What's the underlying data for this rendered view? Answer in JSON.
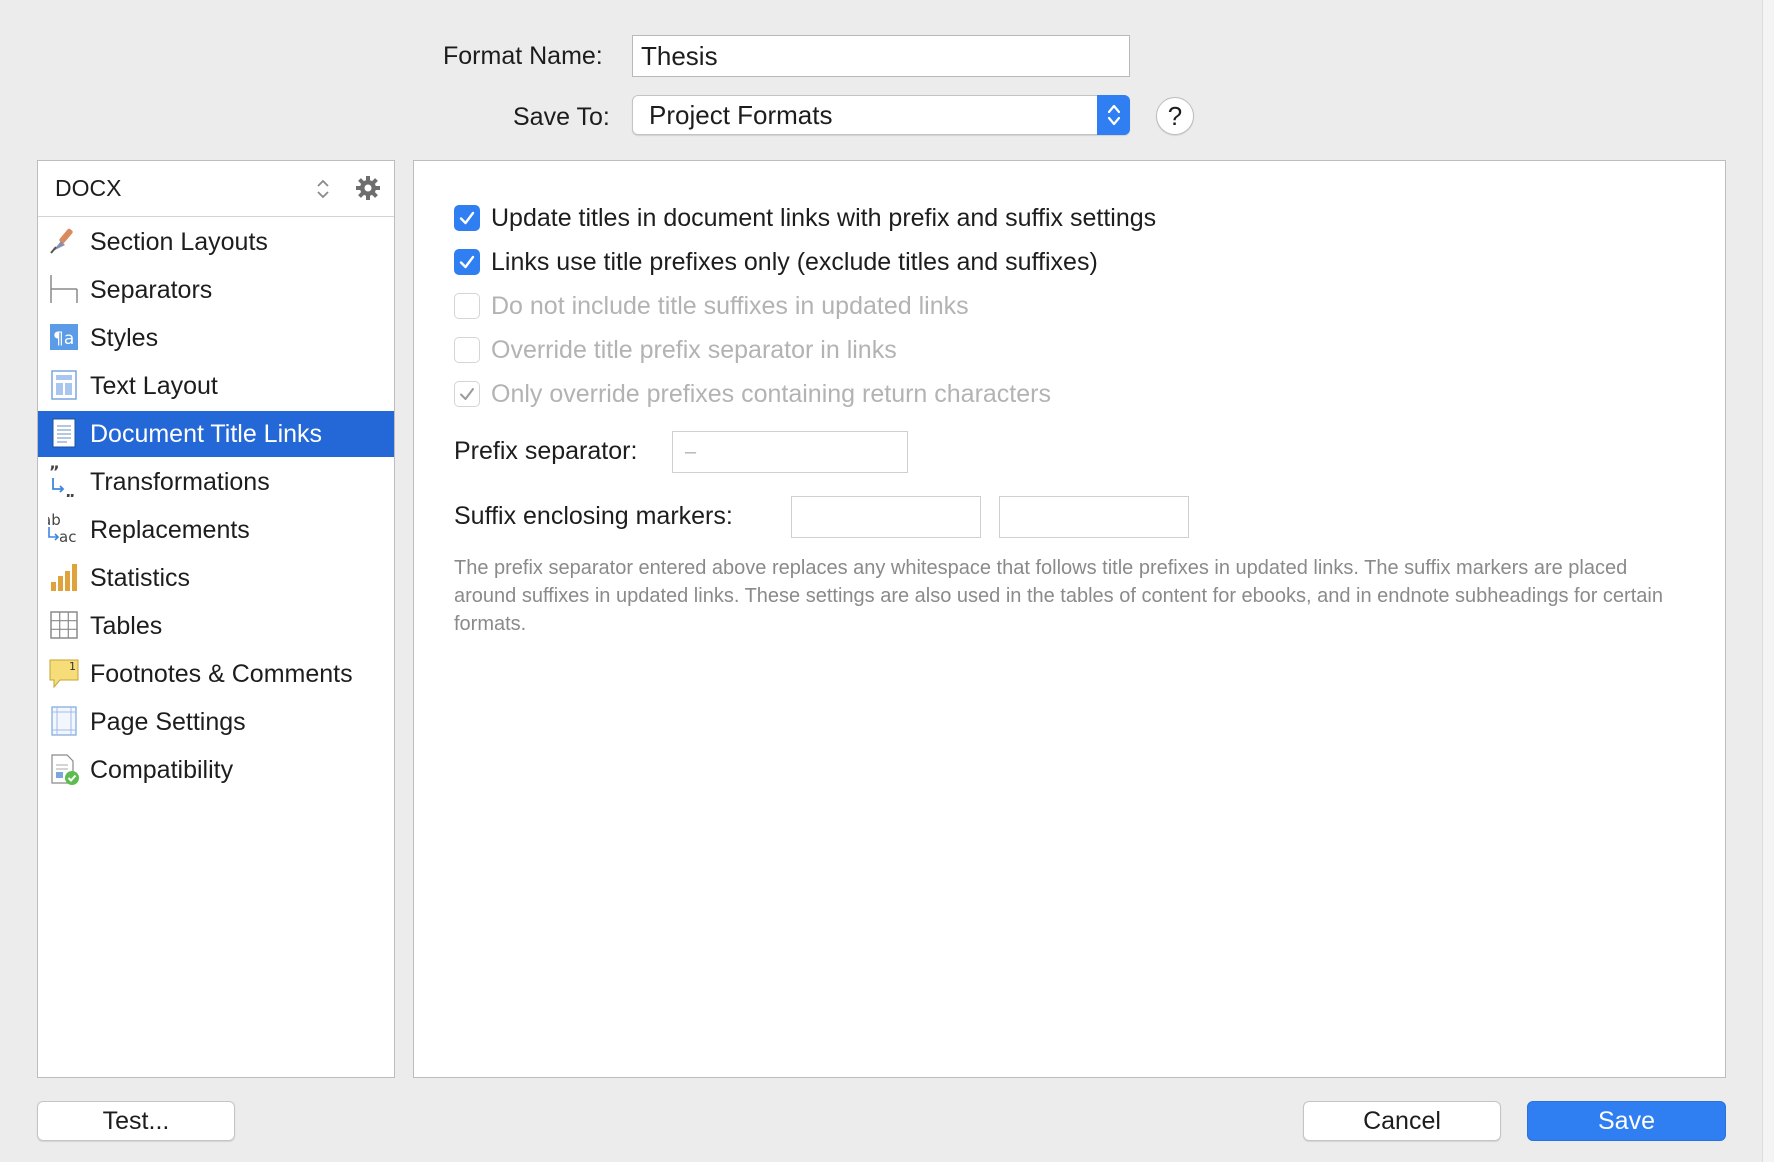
{
  "header": {
    "format_name_label": "Format Name:",
    "format_name_value": "Thesis",
    "save_to_label": "Save To:",
    "save_to_value": "Project Formats",
    "help_label": "?"
  },
  "sidebar": {
    "format_selector": "DOCX",
    "items": [
      {
        "label": "Section Layouts",
        "icon": "paintbrush-icon"
      },
      {
        "label": "Separators",
        "icon": "separators-icon"
      },
      {
        "label": "Styles",
        "icon": "styles-icon"
      },
      {
        "label": "Text Layout",
        "icon": "text-layout-icon"
      },
      {
        "label": "Document Title Links",
        "icon": "document-icon",
        "selected": true
      },
      {
        "label": "Transformations",
        "icon": "quotes-transform-icon"
      },
      {
        "label": "Replacements",
        "icon": "replacements-icon"
      },
      {
        "label": "Statistics",
        "icon": "bar-chart-icon"
      },
      {
        "label": "Tables",
        "icon": "table-icon"
      },
      {
        "label": "Footnotes & Comments",
        "icon": "footnote-icon"
      },
      {
        "label": "Page Settings",
        "icon": "page-settings-icon"
      },
      {
        "label": "Compatibility",
        "icon": "compatibility-icon"
      }
    ]
  },
  "main": {
    "options": [
      {
        "label": "Update titles in document links with prefix and suffix settings",
        "checked": true,
        "enabled": true
      },
      {
        "label": "Links use title prefixes only (exclude titles and suffixes)",
        "checked": true,
        "enabled": true
      },
      {
        "label": "Do not include title suffixes in updated links",
        "checked": false,
        "enabled": false
      },
      {
        "label": "Override title prefix separator in links",
        "checked": false,
        "enabled": false
      },
      {
        "label": "Only override prefixes containing return characters",
        "checked": true,
        "enabled": false
      }
    ],
    "prefix_separator_label": "Prefix separator:",
    "prefix_separator_value": "–",
    "suffix_markers_label": "Suffix enclosing markers:",
    "suffix_marker_open": "",
    "suffix_marker_close": "",
    "note": "The prefix separator entered above replaces any whitespace that follows title prefixes in updated links. The suffix markers are placed around suffixes in updated links. These settings are also used in the tables of content for ebooks, and in endnote subheadings for certain formats."
  },
  "footer": {
    "test_label": "Test...",
    "cancel_label": "Cancel",
    "save_label": "Save"
  },
  "colors": {
    "accent": "#2f7ef2",
    "selection": "#2468d8",
    "window_bg": "#ececec",
    "disabled_text": "#b3b3b3"
  }
}
